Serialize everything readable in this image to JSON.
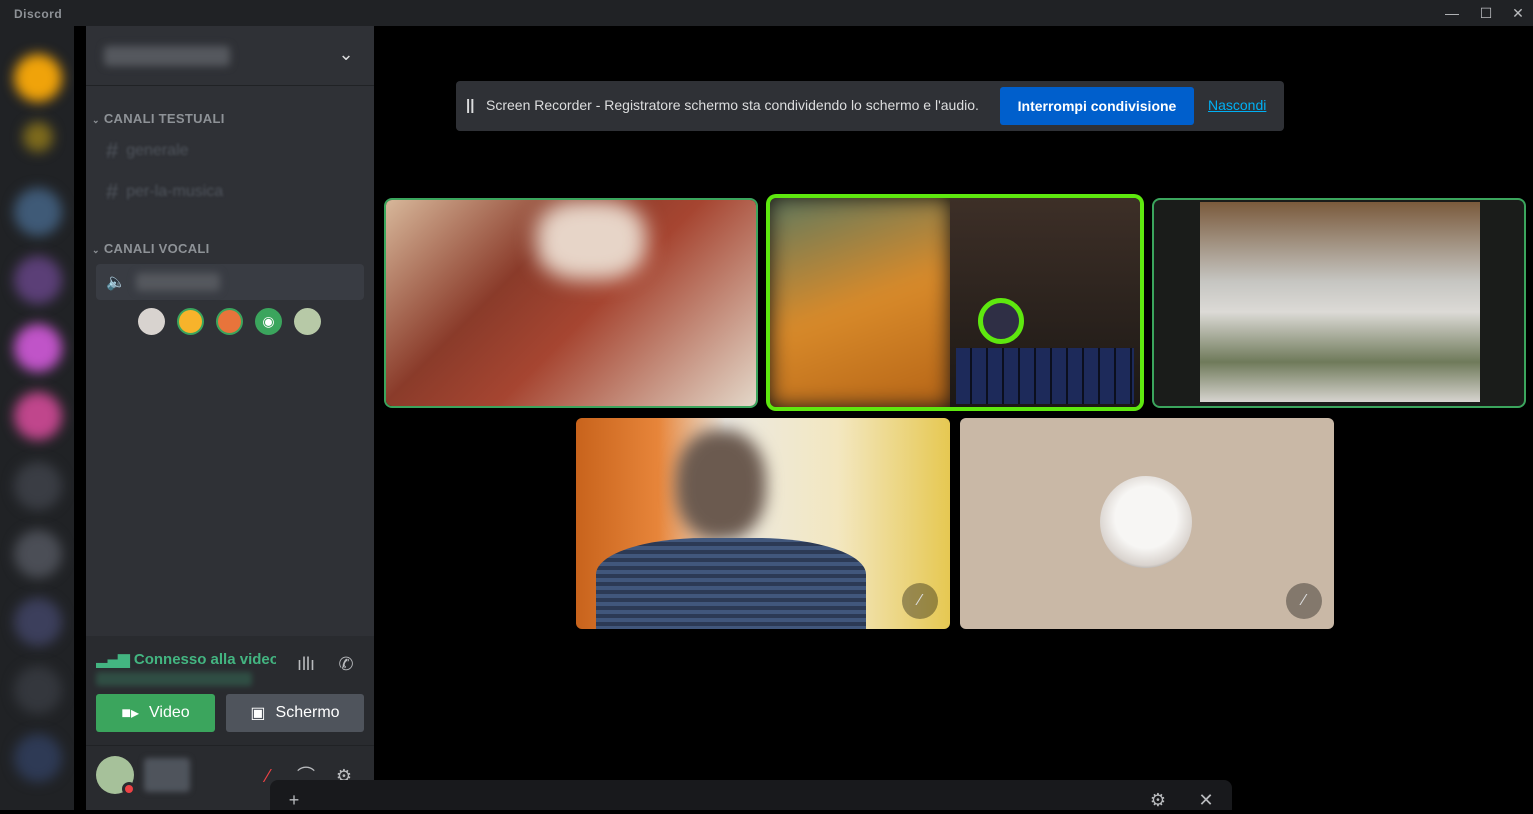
{
  "app": {
    "title": "Discord"
  },
  "window_controls": {
    "minimize": "—",
    "maximize": "☐",
    "close": "✕"
  },
  "sidebar": {
    "chevron": "⌄",
    "categories": {
      "text": "CANALI TESTUALI",
      "voice": "CANALI VOCALI"
    },
    "text_channels": [
      {
        "name": "generale"
      },
      {
        "name": "per-la-musica"
      }
    ]
  },
  "voice_panel": {
    "status": "Connesso alla videoch",
    "video_label": "Video",
    "screen_label": "Schermo"
  },
  "notice": {
    "message": "Screen Recorder - Registratore schermo sta condividendo lo schermo e l'audio.",
    "stop_label": "Interrompi condivisione",
    "hide_label": "Nascondi"
  },
  "colors": {
    "accent_green": "#3ba55d",
    "speaking_border": "#5ee80f",
    "button_blue": "#005fcc",
    "link": "#00b0f4"
  },
  "icons": [
    "chevron-down-icon",
    "hash-icon",
    "speaker-icon",
    "signal-icon",
    "waveform-icon",
    "disconnect-icon",
    "camera-icon",
    "screen-share-icon",
    "mute-icon",
    "headphones-icon",
    "gear-icon",
    "plus-icon",
    "close-icon"
  ]
}
